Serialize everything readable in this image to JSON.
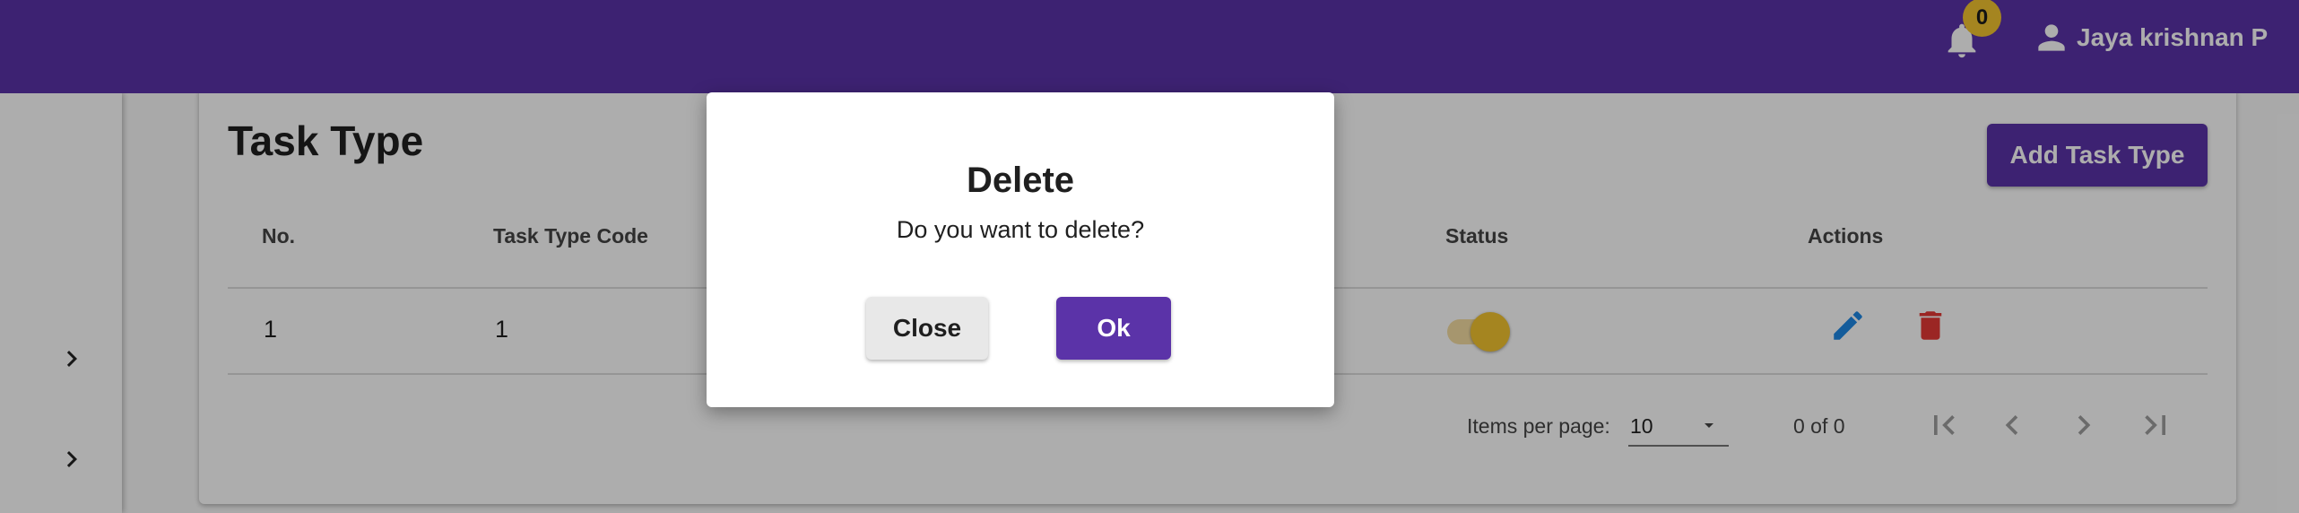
{
  "header": {
    "notification_count": "0",
    "user_name": "Jaya krishnan P",
    "icons": [
      "bell-icon",
      "account-icon"
    ]
  },
  "sidebar": {
    "icons": [
      "chevron-right-icon",
      "chevron-right-icon"
    ]
  },
  "page": {
    "title": "Task Type",
    "add_button_label": "Add Task Type"
  },
  "table": {
    "columns": {
      "no": "No.",
      "code": "Task Type Code",
      "status": "Status",
      "actions": "Actions"
    },
    "rows": [
      {
        "no": "1",
        "code": "1",
        "status_active": true
      }
    ],
    "action_icons": [
      "edit-icon",
      "delete-icon"
    ]
  },
  "pagination": {
    "items_per_page_label": "Items per page:",
    "items_per_page_value": "10",
    "range_label": "0 of 0",
    "icons": [
      "first-page-icon",
      "previous-page-icon",
      "next-page-icon",
      "last-page-icon"
    ]
  },
  "dialog": {
    "title": "Delete",
    "message": "Do you want to delete?",
    "close_label": "Close",
    "ok_label": "Ok"
  },
  "colors": {
    "primary": "#5b33a8",
    "accent": "#f4c430",
    "edit": "#1e88e5",
    "delete": "#e53935"
  }
}
